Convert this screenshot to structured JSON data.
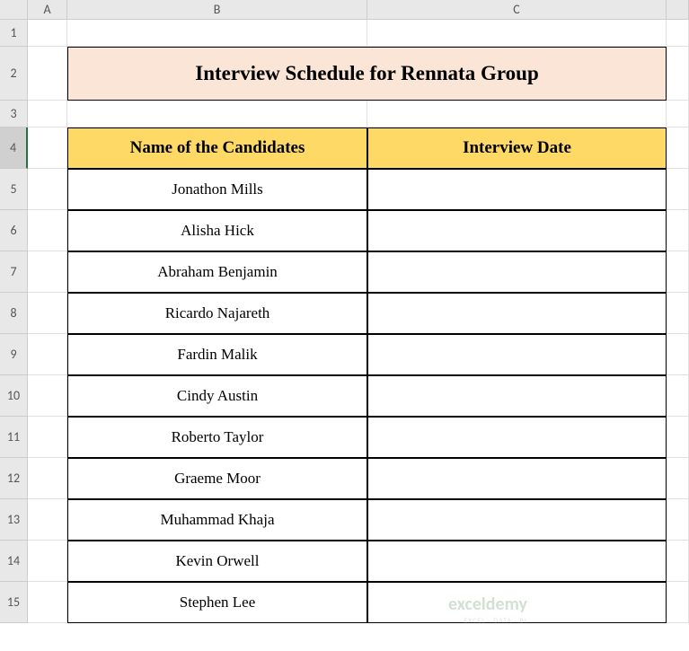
{
  "columns": [
    "A",
    "B",
    "C"
  ],
  "rows": [
    "1",
    "2",
    "3",
    "4",
    "5",
    "6",
    "7",
    "8",
    "9",
    "10",
    "11",
    "12",
    "13",
    "14",
    "15"
  ],
  "selectedRow": "4",
  "title": "Interview Schedule for Rennata Group",
  "headers": {
    "name": "Name of the Candidates",
    "date": "Interview Date"
  },
  "candidates": [
    "Jonathon Mills",
    "Alisha Hick",
    "Abraham Benjamin",
    "Ricardo Najareth",
    "Fardin Malik",
    "Cindy Austin",
    "Roberto Taylor",
    "Graeme Moor",
    "Muhammad Khaja",
    "Kevin Orwell",
    "Stephen Lee"
  ],
  "watermark": {
    "main": "exceldemy",
    "sub": "EXCEL · DATA · BI"
  }
}
